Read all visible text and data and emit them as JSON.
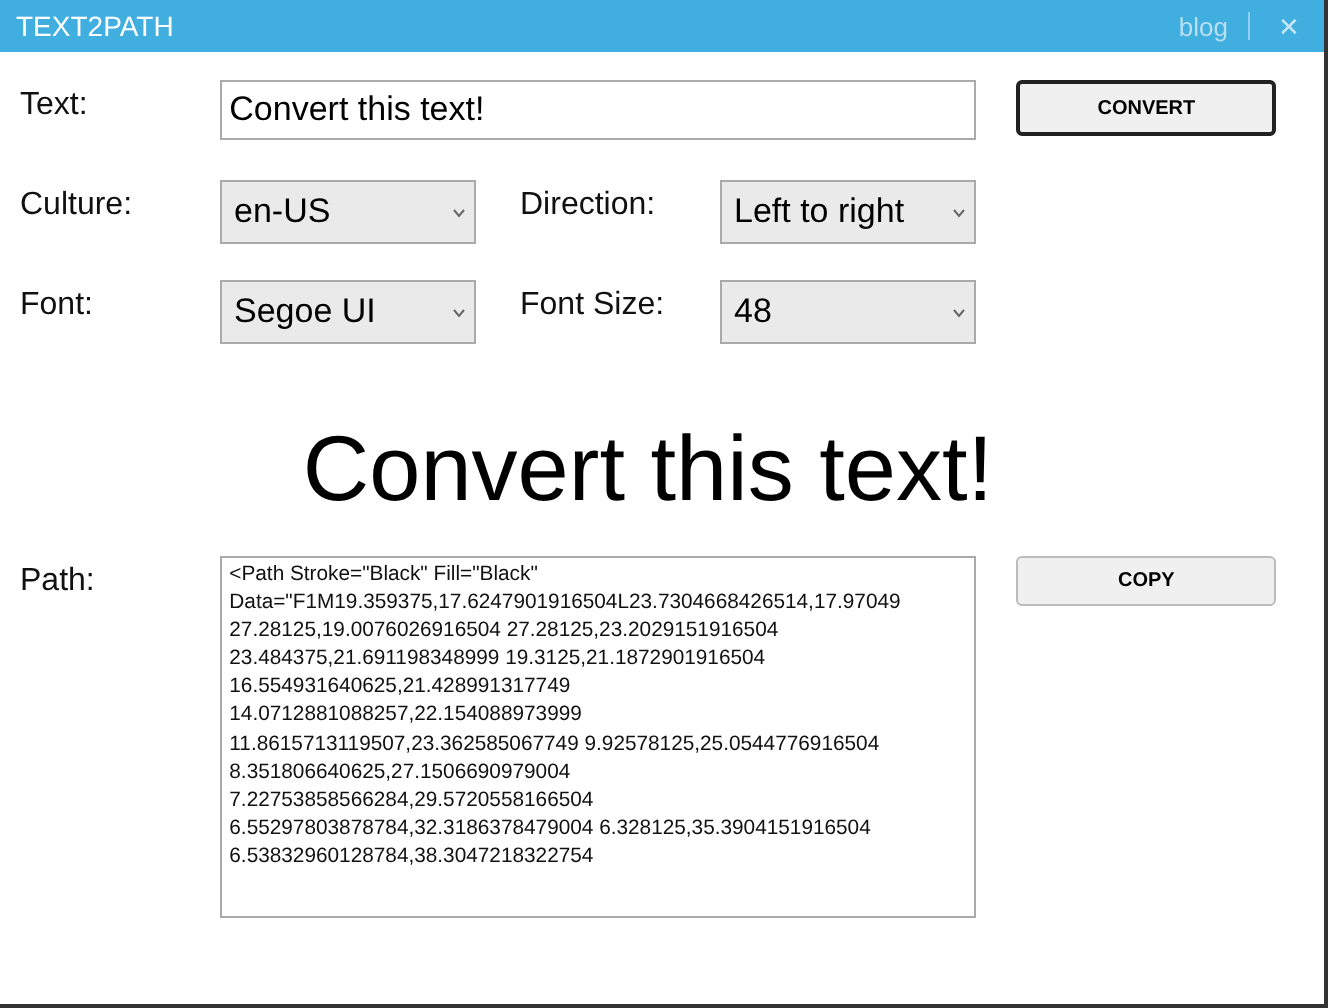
{
  "window": {
    "title": "TEXT2PATH",
    "links": [
      "blog"
    ],
    "close": "✕"
  },
  "text_field": {
    "label": "Text:",
    "value": "Convert this text!"
  },
  "convert_button": "CONVERT",
  "culture": {
    "label": "Culture:",
    "value": "en-US"
  },
  "direction": {
    "label": "Direction:",
    "value": "Left to right"
  },
  "font": {
    "label": "Font:",
    "value": "Segoe UI"
  },
  "font_size": {
    "label": "Font Size:",
    "value": "48"
  },
  "preview": "Convert this text!",
  "path": {
    "label": "Path:",
    "lines": [
      "<Path Stroke=\"Black\" Fill=\"Black\"",
      "Data=\"F1M19.359375,17.6247901916504L23.7304668426514,17.97049",
      "27.28125,19.0076026916504 27.28125,23.2029151916504",
      "23.484375,21.691198348999 19.3125,21.1872901916504",
      "16.554931640625,21.428991317749",
      "14.0712881088257,22.154088973999",
      "11.8615713119507,23.362585067749 9.92578125,25.0544776916504",
      "8.351806640625,27.1506690979004",
      "7.22753858566284,29.5720558166504",
      "6.55297803878784,32.3186378479004 6.328125,35.3904151916504",
      "6.53832960128784,38.3047218322754"
    ]
  },
  "copy_button": "COPY"
}
